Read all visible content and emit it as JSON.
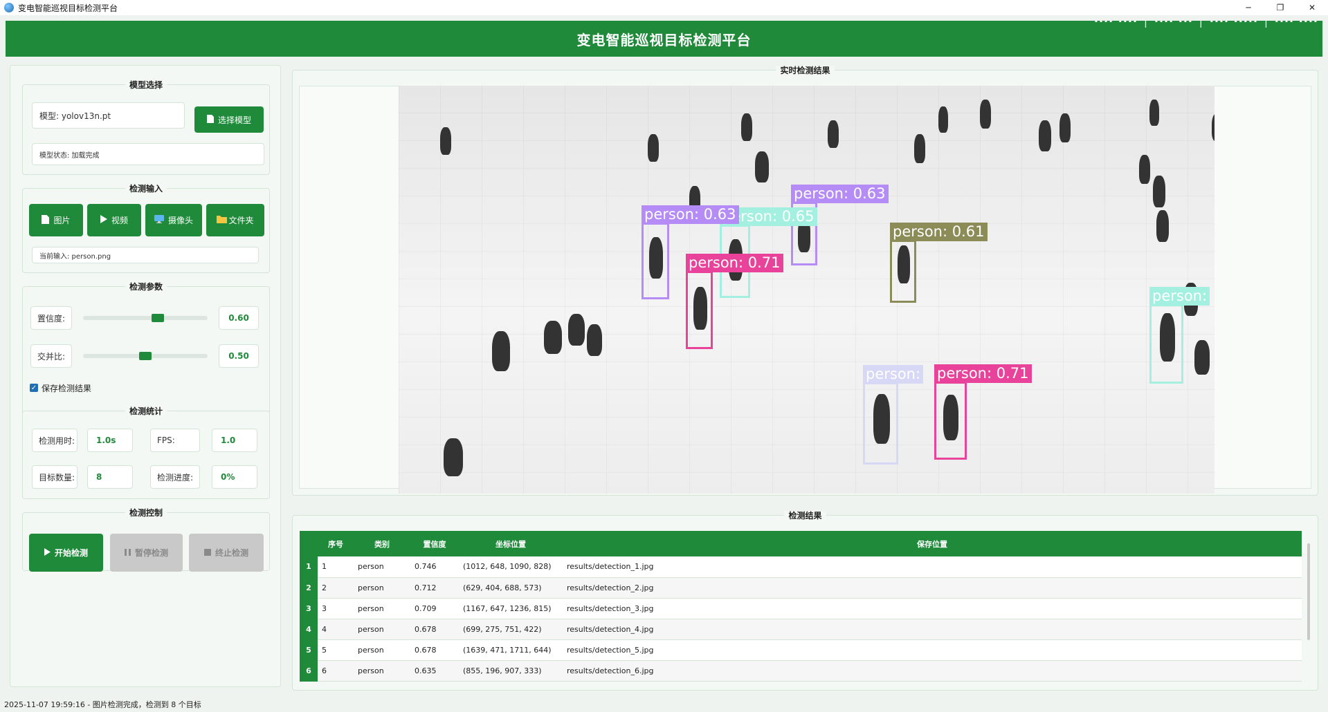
{
  "window": {
    "title": "变电智能巡视目标检测平台",
    "buttons": {
      "minimize": "─",
      "restore": "❐",
      "close": "✕"
    }
  },
  "header": {
    "title": "变电智能巡视目标检测平台",
    "metrics_clipped": "···· ···· │ ···· ··· │ ···· ····· │ ···· ····"
  },
  "model": {
    "section_title": "模型选择",
    "model_label": "模型: yolov13n.pt",
    "select_button": "选择模型",
    "status": "模型状态: 加载完成"
  },
  "input": {
    "section_title": "检测输入",
    "buttons": [
      {
        "label": "图片",
        "icon": "image-file-icon"
      },
      {
        "label": "视频",
        "icon": "play-icon"
      },
      {
        "label": "摄像头",
        "icon": "monitor-icon"
      },
      {
        "label": "文件夹",
        "icon": "folder-icon"
      }
    ],
    "current": "当前输入: person.png"
  },
  "params": {
    "section_title": "检测参数",
    "confidence": {
      "label": "置信度:",
      "value": "0.60",
      "fraction": 0.6
    },
    "iou": {
      "label": "交并比:",
      "value": "0.50",
      "fraction": 0.5
    },
    "save_checkbox": {
      "label": "保存检测结果",
      "checked": true
    }
  },
  "stats": {
    "section_title": "检测统计",
    "time_label": "检测用时:",
    "time_value": "1.0s",
    "fps_label": "FPS:",
    "fps_value": "1.0",
    "count_label": "目标数量:",
    "count_value": "8",
    "progress_label": "检测进度:",
    "progress_value": "0%"
  },
  "control": {
    "section_title": "检测控制",
    "start": "开始检测",
    "pause": "暂停检测",
    "stop": "终止检测"
  },
  "view": {
    "section_title": "实时检测结果",
    "detections": [
      {
        "label": "person: 0.63",
        "color": "#b58cf5"
      },
      {
        "label": "person: 0.65",
        "color": "#a4f0e0"
      },
      {
        "label": "person: 0.63",
        "color": "#b58cf5"
      },
      {
        "label": "person: 0.61",
        "color": "#8b8c57"
      },
      {
        "label": "person: 0.71",
        "color": "#e8429a"
      },
      {
        "label": "person:",
        "color": "#a4f0e0"
      },
      {
        "label": "person:",
        "color": "#d7d8f6"
      },
      {
        "label": "person: 0.71",
        "color": "#e8429a"
      }
    ]
  },
  "results": {
    "section_title": "检测结果",
    "headers": [
      "序号",
      "类别",
      "置信度",
      "坐标位置",
      "保存位置"
    ],
    "rows": [
      {
        "num": "1",
        "id": "1",
        "cls": "person",
        "conf": "0.746",
        "coord": "(1012, 648, 1090, 828)",
        "path": "results/detection_1.jpg"
      },
      {
        "num": "2",
        "id": "2",
        "cls": "person",
        "conf": "0.712",
        "coord": "(629, 404, 688, 573)",
        "path": "results/detection_2.jpg"
      },
      {
        "num": "3",
        "id": "3",
        "cls": "person",
        "conf": "0.709",
        "coord": "(1167, 647, 1236, 815)",
        "path": "results/detection_3.jpg"
      },
      {
        "num": "4",
        "id": "4",
        "cls": "person",
        "conf": "0.678",
        "coord": "(699, 275, 751, 422)",
        "path": "results/detection_4.jpg"
      },
      {
        "num": "5",
        "id": "5",
        "cls": "person",
        "conf": "0.678",
        "coord": "(1639, 471, 1711, 644)",
        "path": "results/detection_5.jpg"
      },
      {
        "num": "6",
        "id": "6",
        "cls": "person",
        "conf": "0.635",
        "coord": "(855, 196, 907, 333)",
        "path": "results/detection_6.jpg"
      }
    ]
  },
  "statusbar": {
    "text": "2025-11-07 19:59:16 - 图片检测完成，检测到 8 个目标"
  },
  "colors": {
    "brand_green": "#1f8a3a",
    "panel_bg": "#f3f8f4",
    "border": "#d4e4d7"
  }
}
